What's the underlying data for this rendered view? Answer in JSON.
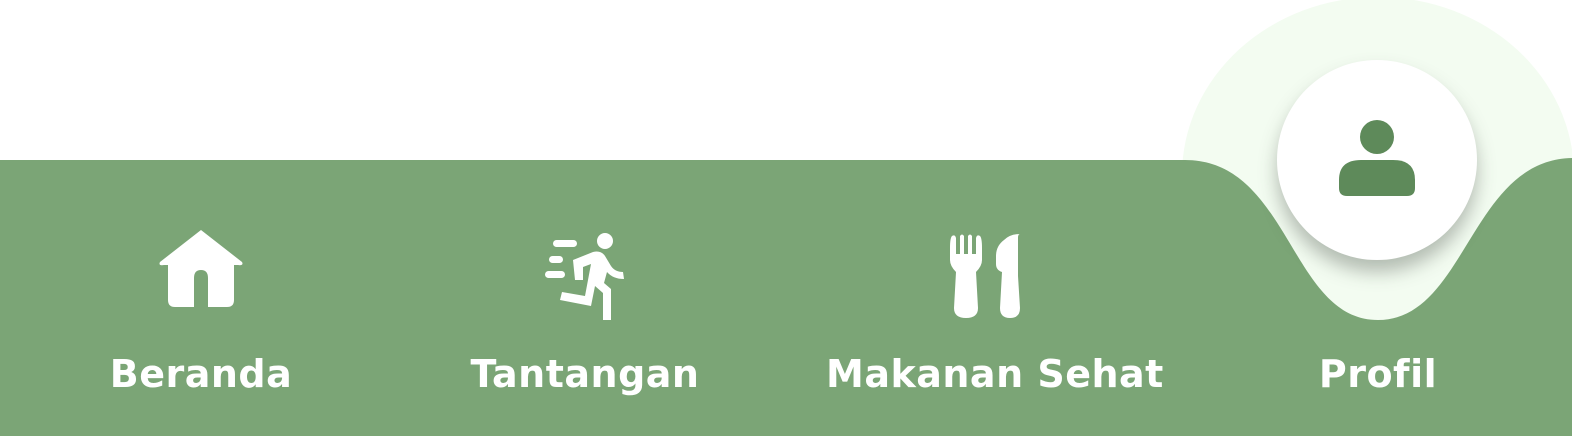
{
  "colors": {
    "bar": "#7ba576",
    "halo": "#f3fcf1",
    "fab": "#ffffff",
    "active_icon": "#5e8a5a",
    "label": "#ffffff"
  },
  "nav": {
    "active": "profil",
    "items": [
      {
        "id": "beranda",
        "label": "Beranda",
        "icon": "home-icon"
      },
      {
        "id": "tantangan",
        "label": "Tantangan",
        "icon": "running-person-icon"
      },
      {
        "id": "makanan",
        "label": "Makanan Sehat",
        "icon": "fork-knife-icon"
      },
      {
        "id": "profil",
        "label": "Profil",
        "icon": "user-icon"
      }
    ]
  }
}
